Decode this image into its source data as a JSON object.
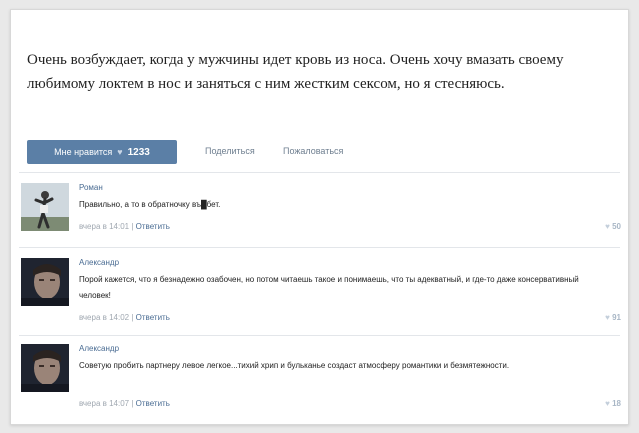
{
  "post": {
    "text": "Очень возбуждает, когда у мужчины идет кровь из носа. Очень хочу вмазать своему любимому локтем в нос и заняться с ним жестким сексом, но я стесняюсь.",
    "like_label": "Мне нравится",
    "like_count": "1233",
    "share_label": "Поделиться",
    "report_label": "Пожаловаться"
  },
  "comments": [
    {
      "author": "Роман",
      "text": "Правильно, а то в обратночку въ█бет.",
      "time": "вчера в 14:01",
      "reply_label": "Ответить",
      "likes": "50"
    },
    {
      "author": "Александр",
      "text": "Порой кажется, что я безнадежно озабочен, но потом читаешь такое и понимаешь, что ты адекватный, и где-то даже консервативный человек!",
      "time": "вчера в 14:02",
      "reply_label": "Ответить",
      "likes": "91"
    },
    {
      "author": "Александр",
      "text": "Советую пробить партнеру левое легкое...тихий хрип и бульканье создаст атмосферу романтики и безмятежности.",
      "time": "вчера в 14:07",
      "reply_label": "Ответить",
      "likes": "18"
    }
  ],
  "colors": {
    "accent": "#5b7fa6",
    "link": "#4a6c93",
    "meta": "#a0a8b1"
  }
}
